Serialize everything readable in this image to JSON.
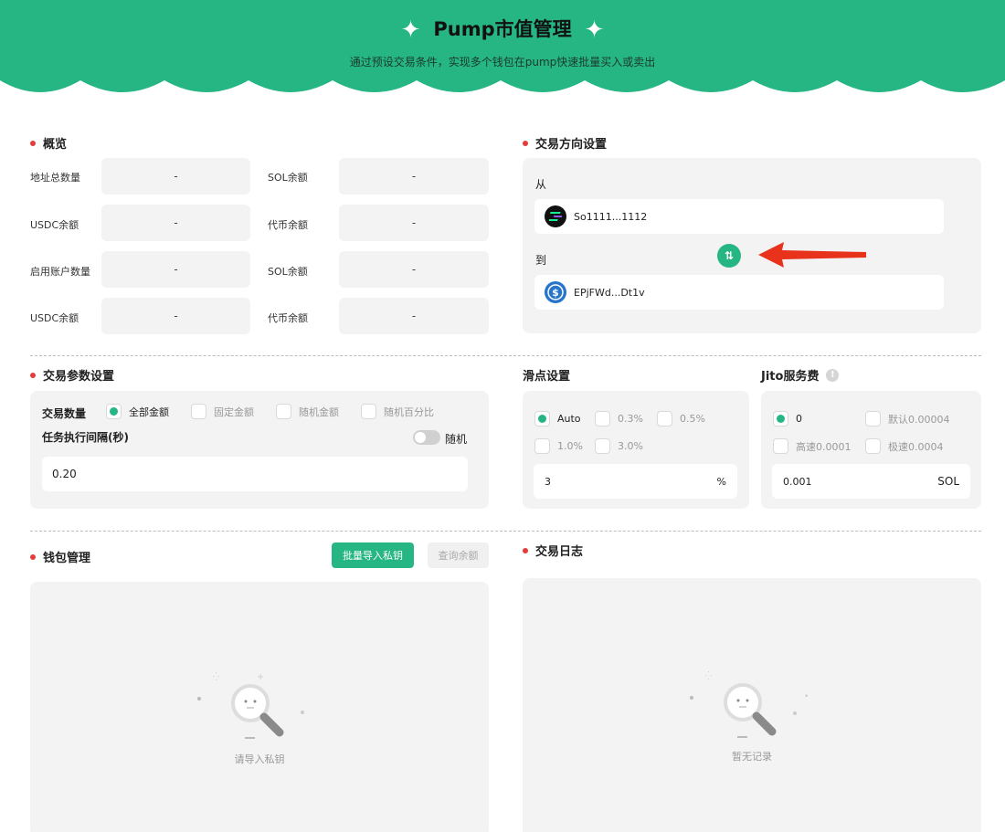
{
  "header": {
    "title": "Pump市值管理",
    "subtitle": "通过预设交易条件，实现多个钱包在pump快速批量买入或卖出",
    "spark_icon": "✦",
    "bg_color": "#26b684"
  },
  "overview": {
    "title": "概览",
    "rows": [
      {
        "left_label": "地址总数量",
        "left_value": "-",
        "right_label": "SOL余额",
        "right_value": "-"
      },
      {
        "left_label": "USDC余额",
        "left_value": "-",
        "right_label": "代币余额",
        "right_value": "-"
      },
      {
        "left_label": "启用账户数量",
        "left_value": "-",
        "right_label": "SOL余额",
        "right_value": "-"
      },
      {
        "left_label": "USDC余额",
        "left_value": "-",
        "right_label": "代币余额",
        "right_value": "-"
      }
    ]
  },
  "direction": {
    "title": "交易方向设置",
    "from_label": "从",
    "from_token": "So1111...1112",
    "from_icon": "solana-icon",
    "to_label": "到",
    "to_token": "EPjFWd...Dt1v",
    "to_icon": "usdc-icon",
    "swap_icon": "⇅"
  },
  "params": {
    "title": "交易参数设置",
    "amount_label": "交易数量",
    "options": [
      "全部金额",
      "固定金额",
      "随机金额",
      "随机百分比"
    ],
    "selected_option": "全部金额",
    "interval_label": "任务执行间隔(秒)",
    "random_label": "随机",
    "random_enabled": false,
    "interval_value": "0.20"
  },
  "slippage": {
    "title": "滑点设置",
    "options": [
      "Auto",
      "0.3%",
      "0.5%",
      "1.0%",
      "3.0%"
    ],
    "selected_option": "Auto",
    "value": "3",
    "unit": "%"
  },
  "jito": {
    "title": "Jito服务费",
    "info_icon": "!",
    "options": [
      "0",
      "默认0.00004",
      "高速0.0001",
      "极速0.0004"
    ],
    "selected_option": "0",
    "value": "0.001",
    "unit": "SOL"
  },
  "wallet": {
    "title": "钱包管理",
    "import_button": "批量导入私钥",
    "query_button": "查询余额",
    "empty_text": "请导入私钥"
  },
  "log": {
    "title": "交易日志",
    "empty_text": "暂无记录"
  }
}
